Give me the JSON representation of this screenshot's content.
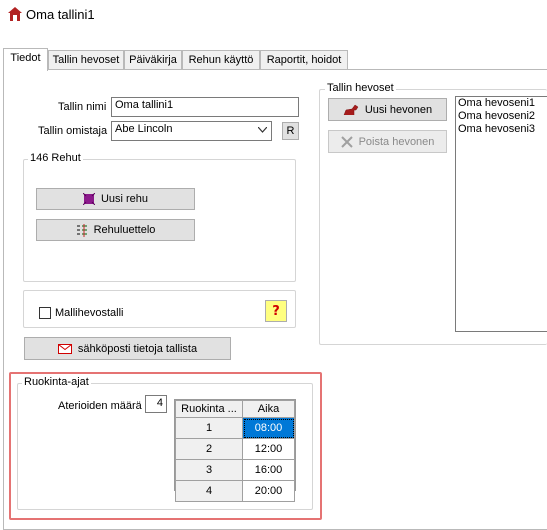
{
  "window": {
    "title": "Oma tallini1",
    "app_icon": "barn-icon"
  },
  "tabs": [
    "Tiedot",
    "Tallin hevoset",
    "Päiväkirja",
    "Rehun käyttö",
    "Raportit, hoidot"
  ],
  "active_tab": "Tiedot",
  "stable": {
    "name_label": "Tallin nimi",
    "name_value": "Oma tallini1",
    "owner_label": "Tallin omistaja",
    "owner_value": "Abe Lincoln",
    "r_button": "R"
  },
  "feeds": {
    "group_title": "146 Rehut",
    "new_feed_button": "Uusi rehu",
    "feed_list_button": "Rehuluettelo"
  },
  "model_stable": {
    "checkbox_label": "Mallihevostalli",
    "checked": false,
    "help_icon": "question-icon"
  },
  "email_button": "sähköposti tietoja tallista",
  "horses": {
    "group_title": "Tallin hevoset",
    "new_horse_button": "Uusi hevonen",
    "remove_horse_button": "Poista hevonen",
    "list": [
      "Oma hevoseni1",
      "Oma hevoseni2",
      "Oma hevoseni3"
    ]
  },
  "feeding": {
    "group_title": "Ruokinta-ajat",
    "meals_label": "Aterioiden määrä",
    "meals_value": "4",
    "columns": [
      "Ruokinta ...",
      "Aika"
    ],
    "rows": [
      {
        "n": "1",
        "time": "08:00"
      },
      {
        "n": "2",
        "time": "12:00"
      },
      {
        "n": "3",
        "time": "16:00"
      },
      {
        "n": "4",
        "time": "20:00"
      }
    ],
    "selected_row": 0
  },
  "colors": {
    "highlight": "#e57373",
    "selection": "#0078d7"
  }
}
